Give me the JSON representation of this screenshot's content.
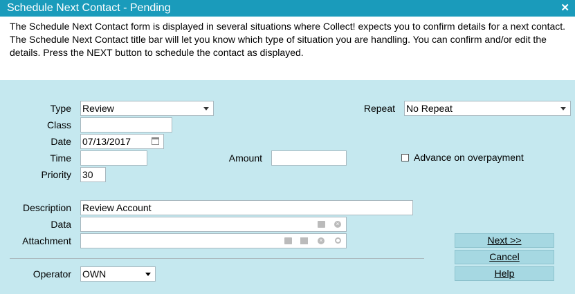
{
  "window": {
    "title": "Schedule Next Contact - Pending",
    "close_glyph": "✕"
  },
  "info_text": "The Schedule Next Contact form is displayed in several situations where Collect! expects you to confirm details for a next contact. The Schedule Next Contact title bar will let you know which type of situation you are handling. You can confirm and/or edit the details. Press the NEXT button to schedule the contact as displayed.",
  "form": {
    "type": {
      "label": "Type",
      "value": "Review"
    },
    "class": {
      "label": "Class",
      "value": ""
    },
    "date": {
      "label": "Date",
      "value": "07/13/2017"
    },
    "time": {
      "label": "Time",
      "value": ""
    },
    "priority": {
      "label": "Priority",
      "value": "30"
    },
    "amount": {
      "label": "Amount",
      "value": ""
    },
    "repeat": {
      "label": "Repeat",
      "value": "No Repeat"
    },
    "advance": {
      "label": "Advance on overpayment",
      "checked": false
    },
    "description": {
      "label": "Description",
      "value": "Review Account"
    },
    "data": {
      "label": "Data",
      "value": ""
    },
    "attachment": {
      "label": "Attachment",
      "value": ""
    },
    "operator": {
      "label": "Operator",
      "value": "OWN"
    }
  },
  "buttons": {
    "next": "Next >>",
    "cancel": "Cancel",
    "help": "Help"
  },
  "icons": [
    "close-icon",
    "dropdown-arrow-icon",
    "calendar-icon",
    "folder-icon",
    "clear-icon",
    "print-icon",
    "search-icon"
  ]
}
